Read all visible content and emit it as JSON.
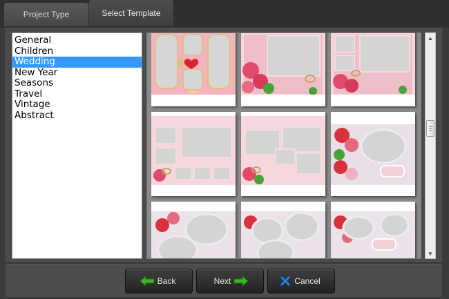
{
  "tabs": [
    {
      "label": "Project Type"
    },
    {
      "label": "Select Template"
    }
  ],
  "categories": {
    "items": [
      "General",
      "Children",
      "Wedding",
      "New Year",
      "Seasons",
      "Travel",
      "Vintage",
      "Abstract"
    ],
    "selected": "Wedding"
  },
  "templates": {
    "rows_visible": 3,
    "columns": 3
  },
  "buttons": {
    "back": "Back",
    "next": "Next",
    "cancel": "Cancel"
  },
  "colors": {
    "selection": "#3399ff",
    "arrow_green": "#3fb12a",
    "cancel_blue": "#2a8cf0"
  },
  "icons": {
    "back": "arrow-left-icon",
    "next": "arrow-right-icon",
    "cancel": "x-icon"
  }
}
